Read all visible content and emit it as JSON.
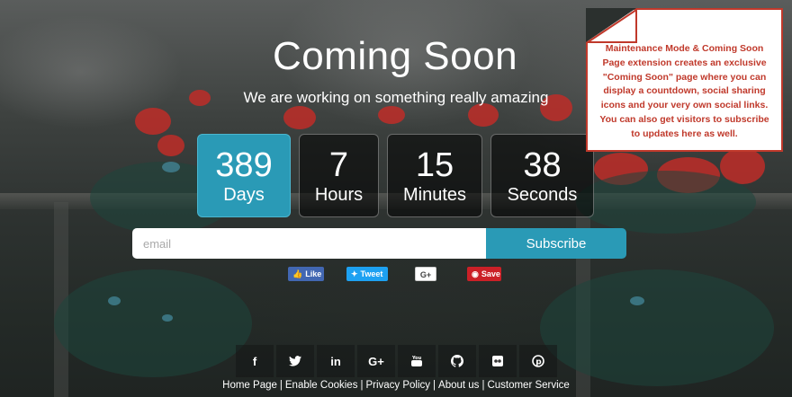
{
  "page": {
    "title": "Coming Soon",
    "subtitle": "We are working on something really amazing"
  },
  "countdown": [
    {
      "value": "389",
      "unit": "Days"
    },
    {
      "value": "7",
      "unit": "Hours"
    },
    {
      "value": "15",
      "unit": "Minutes"
    },
    {
      "value": "38",
      "unit": "Seconds"
    }
  ],
  "subscribe": {
    "placeholder": "email",
    "button_label": "Subscribe"
  },
  "share_buttons": {
    "facebook": "Like",
    "twitter": "Tweet",
    "google": "G+",
    "pinterest": "Save"
  },
  "social_links": [
    "facebook-icon",
    "twitter-icon",
    "linkedin-icon",
    "google-plus-icon",
    "youtube-icon",
    "github-icon",
    "flickr-icon",
    "pinterest-icon"
  ],
  "footer": {
    "links": [
      "Home Page",
      "Enable Cookies",
      "Privacy Policy",
      "About us",
      "Customer Service"
    ]
  },
  "note": {
    "text": "Maintenance Mode & Coming Soon Page extension creates an exclusive \"Coming Soon\" page where you can display a countdown, social sharing icons and your very own social links. You can also get visitors to subscribe to updates here as well."
  },
  "colors": {
    "accent": "#2a9ab6",
    "note_red": "#c0392b"
  }
}
